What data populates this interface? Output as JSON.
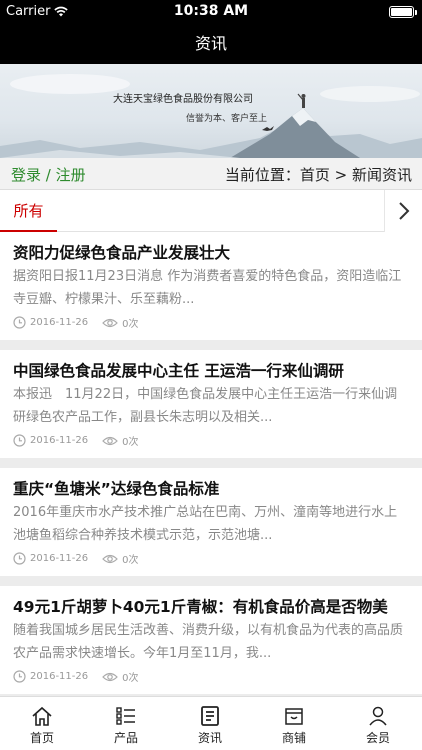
{
  "status_bar": {
    "carrier": "Carrier",
    "time": "10:38 AM"
  },
  "nav": {
    "title": "资讯"
  },
  "banner": {
    "company": "大连天宝绿色食品股份有限公司",
    "slogan": "信誉为本、客户至上"
  },
  "user_row": {
    "login": "登录",
    "separator": " / ",
    "register": "注册",
    "breadcrumb": "当前位置：首页 > 新闻资讯"
  },
  "category_tabs": {
    "active": "所有"
  },
  "articles": [
    {
      "title": "资阳力促绿色食品产业发展壮大",
      "summary": "据资阳日报11月23日消息 作为消费者喜爱的特色食品，资阳造临江寺豆瓣、柠檬果汁、乐至藕粉...",
      "date": "2016-11-26",
      "views": "0次"
    },
    {
      "title": "中国绿色食品发展中心主任 王运浩一行来仙调研",
      "summary": "本报迅　11月22日，中国绿色食品发展中心主任王运浩一行来仙调研绿色农产品工作，副县长朱志明以及相关...",
      "date": "2016-11-26",
      "views": "0次"
    },
    {
      "title": "重庆“鱼塘米”达绿色食品标准",
      "summary": "2016年重庆市水产技术推广总站在巴南、万州、潼南等地进行水上池塘鱼稻综合种养技术模式示范，示范池塘...",
      "date": "2016-11-26",
      "views": "0次"
    },
    {
      "title": "49元1斤胡萝卜40元1斤青椒：有机食品价高是否物美",
      "summary": "随着我国城乡居民生活改善、消费升级，以有机食品为代表的高品质农产品需求快速增长。今年1月至11月，我...",
      "date": "2016-11-26",
      "views": "0次"
    }
  ],
  "tabbar": {
    "items": [
      {
        "label": "首页",
        "icon": "home-icon"
      },
      {
        "label": "产品",
        "icon": "list-icon"
      },
      {
        "label": "资讯",
        "icon": "news-icon"
      },
      {
        "label": "商铺",
        "icon": "store-icon"
      },
      {
        "label": "会员",
        "icon": "user-icon"
      }
    ]
  },
  "colors": {
    "accent_red": "#cc0000",
    "login_green": "#2e8b2e",
    "nav_bg": "#000000"
  }
}
